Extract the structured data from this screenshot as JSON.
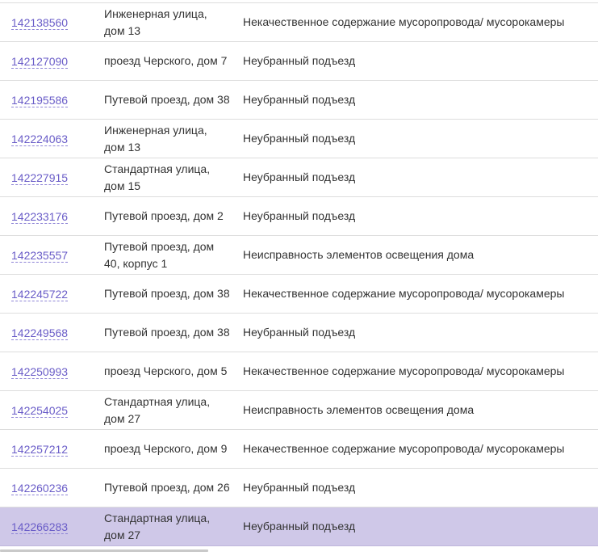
{
  "rows": [
    {
      "id": "142138560",
      "address": "Инженерная улица, дом 13",
      "issue": "Некачественное содержание мусоропровода/ мусорокамеры"
    },
    {
      "id": "142127090",
      "address": "проезд Черского, дом 7",
      "issue": "Неубранный подъезд"
    },
    {
      "id": "142195586",
      "address": "Путевой проезд, дом 38",
      "issue": "Неубранный подъезд"
    },
    {
      "id": "142224063",
      "address": "Инженерная улица, дом 13",
      "issue": "Неубранный подъезд"
    },
    {
      "id": "142227915",
      "address": "Стандартная улица, дом 15",
      "issue": "Неубранный подъезд"
    },
    {
      "id": "142233176",
      "address": "Путевой проезд, дом 2",
      "issue": "Неубранный подъезд"
    },
    {
      "id": "142235557",
      "address": "Путевой проезд, дом 40, корпус 1",
      "issue": "Неисправность элементов освещения дома"
    },
    {
      "id": "142245722",
      "address": "Путевой проезд, дом 38",
      "issue": "Некачественное содержание мусоропровода/ мусорокамеры"
    },
    {
      "id": "142249568",
      "address": "Путевой проезд, дом 38",
      "issue": "Неубранный подъезд"
    },
    {
      "id": "142250993",
      "address": "проезд Черского, дом 5",
      "issue": "Некачественное содержание мусоропровода/ мусорокамеры"
    },
    {
      "id": "142254025",
      "address": "Стандартная улица, дом 27",
      "issue": "Неисправность элементов освещения дома"
    },
    {
      "id": "142257212",
      "address": "проезд Черского, дом 9",
      "issue": "Некачественное содержание мусоропровода/ мусорокамеры"
    },
    {
      "id": "142260236",
      "address": "Путевой проезд, дом 26",
      "issue": "Неубранный подъезд"
    },
    {
      "id": "142266283",
      "address": "Стандартная улица, дом 27",
      "issue": "Неубранный подъезд"
    }
  ],
  "colors": {
    "link": "#6a5dc8",
    "selected_row": "#cfc8e8",
    "text": "#333333",
    "divider": "#dddddd"
  }
}
